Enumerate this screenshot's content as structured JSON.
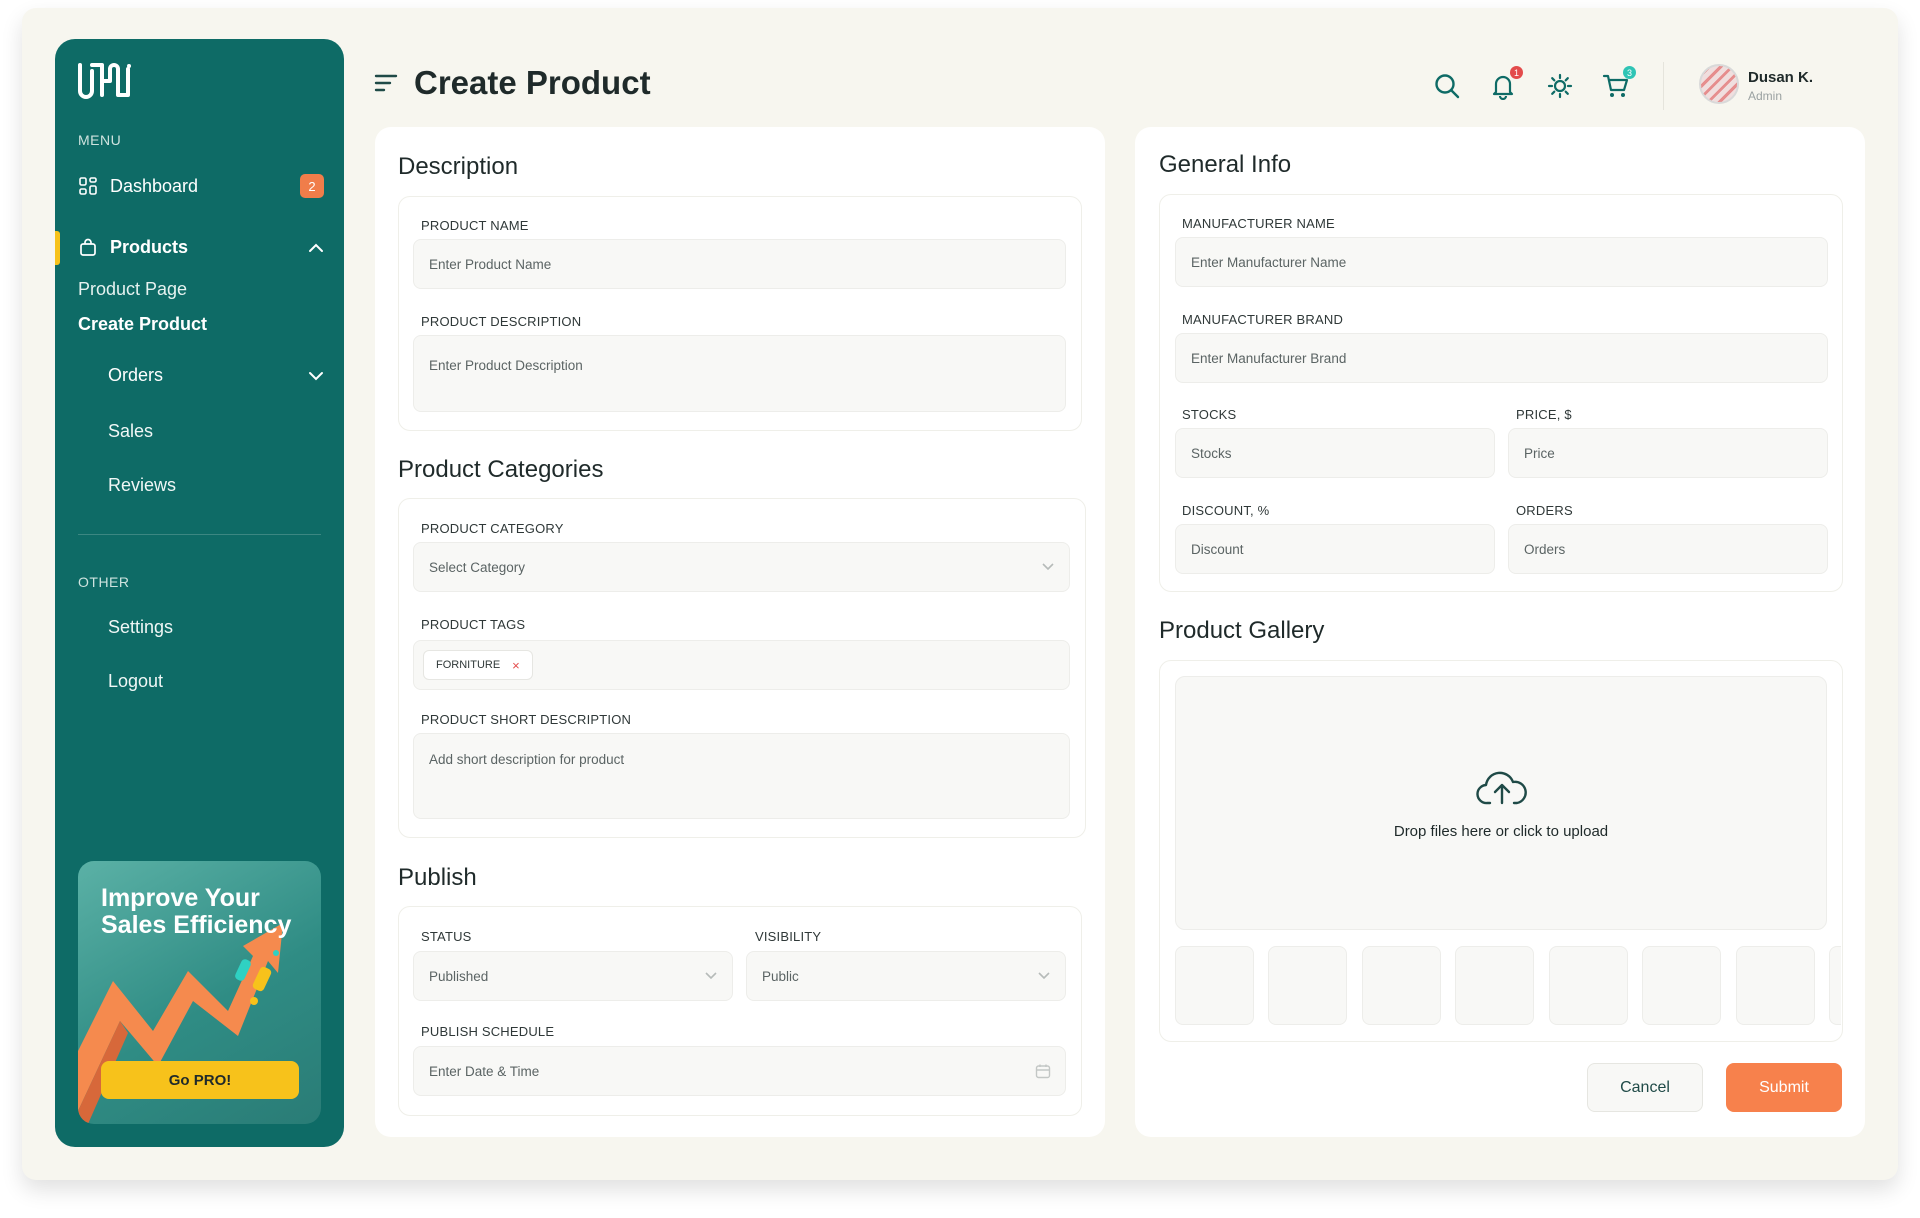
{
  "header": {
    "title": "Create Product",
    "notifications_count": "1",
    "cart_count": "3",
    "user_name": "Dusan K.",
    "user_role": "Admin"
  },
  "sidebar": {
    "menu_label": "MENU",
    "other_label": "OTHER",
    "dashboard": {
      "label": "Dashboard",
      "badge": "2"
    },
    "products": {
      "label": "Products",
      "sub": [
        "Product Page",
        "Create Product"
      ]
    },
    "orders": "Orders",
    "sales": "Sales",
    "reviews": "Reviews",
    "settings": "Settings",
    "logout": "Logout",
    "promo": {
      "title": "Improve Your Sales Efficiency",
      "button": "Go PRO!"
    }
  },
  "description": {
    "title": "Description",
    "name_label": "PRODUCT NAME",
    "name_placeholder": "Enter Product Name",
    "desc_label": "PRODUCT DESCRIPTION",
    "desc_placeholder": "Enter Product Description"
  },
  "categories": {
    "title": "Product Categories",
    "category_label": "PRODUCT CATEGORY",
    "category_value": "Select Category",
    "tags_label": "PRODUCT TAGS",
    "tags": [
      "FORNITURE"
    ],
    "short_label": "PRODUCT SHORT DESCRIPTION",
    "short_placeholder": "Add short description for product"
  },
  "publish": {
    "title": "Publish",
    "status_label": "STATUS",
    "status_value": "Published",
    "visibility_label": "VISIBILITY",
    "visibility_value": "Public",
    "schedule_label": "PUBLISH SCHEDULE",
    "schedule_placeholder": "Enter  Date & Time"
  },
  "general": {
    "title": "General Info",
    "mname_label": "MANUFACTURER NAME",
    "mname_placeholder": "Enter Manufacturer  Name",
    "mbrand_label": "MANUFACTURER BRAND",
    "mbrand_placeholder": "Enter Manufacturer  Brand",
    "stocks_label": "STOCKS",
    "stocks_placeholder": "Stocks",
    "price_label": "PRICE, $",
    "price_placeholder": "Price",
    "discount_label": "DISCOUNT, %",
    "discount_placeholder": "Discount",
    "orders_label": "ORDERS",
    "orders_placeholder": "Orders"
  },
  "gallery": {
    "title": "Product Gallery",
    "drop_text": "Drop files here or click to upload"
  },
  "actions": {
    "cancel": "Cancel",
    "submit": "Submit"
  },
  "colors": {
    "brand": "#0e6b66",
    "accent": "#f7814c",
    "highlight": "#f7c21b",
    "danger": "#e34b4b"
  }
}
